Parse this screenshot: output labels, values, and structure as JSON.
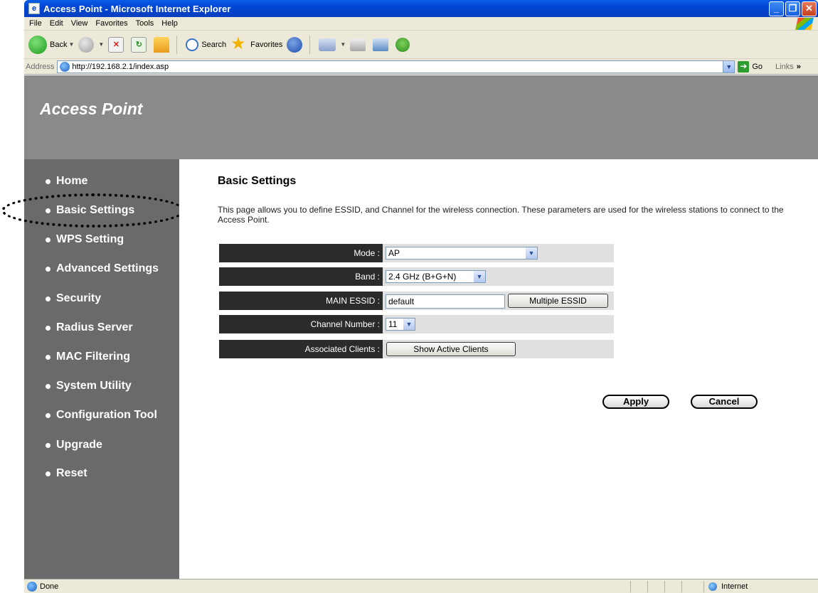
{
  "window": {
    "title": "Access Point - Microsoft Internet Explorer"
  },
  "menu": [
    "File",
    "Edit",
    "View",
    "Favorites",
    "Tools",
    "Help"
  ],
  "toolbar": {
    "back": "Back",
    "search": "Search",
    "favorites": "Favorites"
  },
  "address": {
    "label": "Address",
    "url": "http://192.168.2.1/index.asp",
    "go": "Go",
    "links": "Links",
    "links_more": "»"
  },
  "header": {
    "brand": "Access Point"
  },
  "sidebar": {
    "items": [
      {
        "label": "Home"
      },
      {
        "label": "Basic Settings"
      },
      {
        "label": "WPS Setting"
      },
      {
        "label": "Advanced Settings"
      },
      {
        "label": "Security"
      },
      {
        "label": "Radius Server"
      },
      {
        "label": "MAC Filtering"
      },
      {
        "label": "System Utility"
      },
      {
        "label": "Configuration Tool"
      },
      {
        "label": "Upgrade"
      },
      {
        "label": "Reset"
      }
    ]
  },
  "main": {
    "title": "Basic Settings",
    "description": "This page allows you to define ESSID, and Channel for the wireless connection. These parameters are used for the wireless stations to connect to the Access Point.",
    "form": {
      "mode": {
        "label": "Mode :",
        "value": "AP"
      },
      "band": {
        "label": "Band :",
        "value": "2.4 GHz (B+G+N)"
      },
      "essid": {
        "label": "MAIN ESSID :",
        "value": "default",
        "button": "Multiple ESSID"
      },
      "channel": {
        "label": "Channel Number :",
        "value": "11"
      },
      "clients": {
        "label": "Associated Clients :",
        "button": "Show Active Clients"
      }
    },
    "apply": "Apply",
    "cancel": "Cancel"
  },
  "status": {
    "text": "Done",
    "zone": "Internet"
  }
}
